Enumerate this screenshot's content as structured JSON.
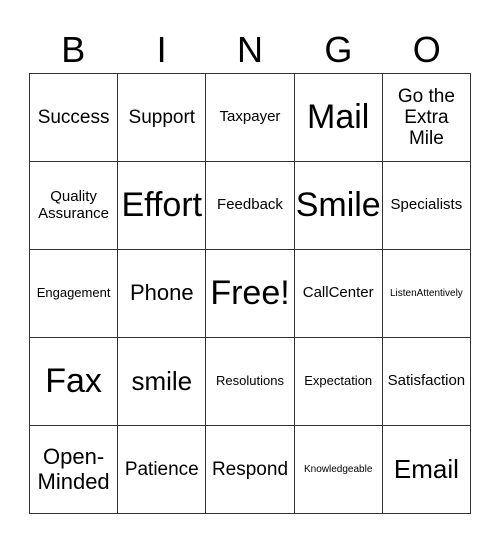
{
  "header": {
    "letters": [
      "B",
      "I",
      "N",
      "G",
      "O"
    ]
  },
  "card": {
    "rows": [
      [
        "Success",
        "Support",
        "Taxpayer",
        "Mail",
        "Go the Extra Mile"
      ],
      [
        "Quality Assurance",
        "Effort",
        "Feedback",
        "Smile",
        "Specialists"
      ],
      [
        "Engagement",
        "Phone",
        "Free!",
        "CallCenter",
        "ListenAttentively"
      ],
      [
        "Fax",
        "smile",
        "Resolutions",
        "Expectation",
        "Satisfaction"
      ],
      [
        "Open-Minded",
        "Patience",
        "Respond",
        "Knowledgeable",
        "Email"
      ]
    ]
  }
}
